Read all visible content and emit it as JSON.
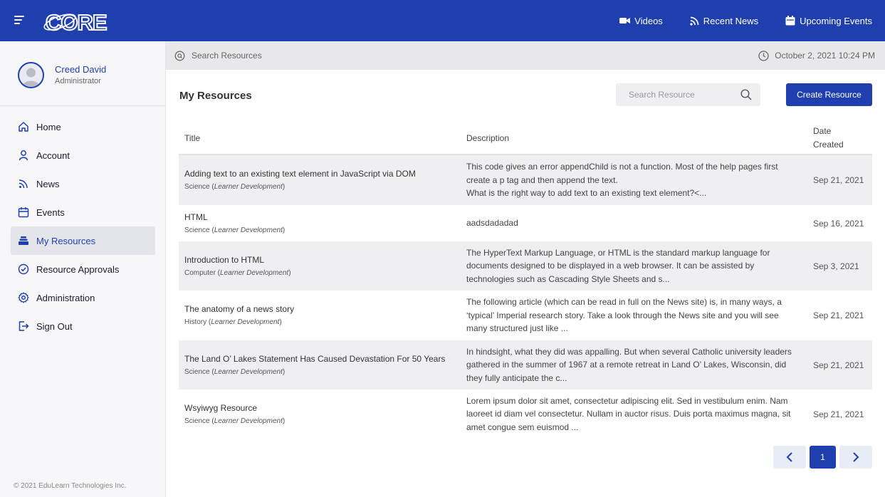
{
  "app": {
    "logo_text": "CORE",
    "brand_color": "#1f3fae"
  },
  "topnav": [
    {
      "label": "Videos",
      "icon": "video-camera-icon"
    },
    {
      "label": "Recent News",
      "icon": "rss-icon"
    },
    {
      "label": "Upcoming Events",
      "icon": "calendar-icon"
    }
  ],
  "profile": {
    "name": "Creed David",
    "role": "Administrator"
  },
  "sidebar": {
    "items": [
      {
        "label": "Home",
        "icon": "home-icon"
      },
      {
        "label": "Account",
        "icon": "user-icon"
      },
      {
        "label": "News",
        "icon": "rss-icon"
      },
      {
        "label": "Events",
        "icon": "calendar-icon"
      },
      {
        "label": "My Resources",
        "icon": "stack-icon",
        "active": true
      },
      {
        "label": "Resource Approvals",
        "icon": "check-circle-icon"
      },
      {
        "label": "Administration",
        "icon": "gear-icon"
      },
      {
        "label": "Sign Out",
        "icon": "sign-out-icon"
      }
    ],
    "copyright": "© 2021 EduLearn Technologies Inc."
  },
  "subbar": {
    "search_placeholder": "Search Resources",
    "datetime": "October 2, 2021 10:24 PM"
  },
  "main": {
    "title": "My Resources",
    "search_placeholder": "Search Resource",
    "create_label": "Create Resource",
    "columns": [
      "Title",
      "Description",
      "Date Created"
    ],
    "rows": [
      {
        "title": "Adding text to an existing text element in JavaScript via DOM",
        "category": "Science",
        "group": "Learner Development",
        "description": "This code gives an error appendChild is not a function. Most of the help pages first create a p tag and then append the text.\nWhat is the right way to add text to an existing text element?<...",
        "date": "Sep 21, 2021"
      },
      {
        "title": "HTML",
        "category": "Science",
        "group": "Learner Development",
        "description": "aadsdadadad",
        "date": "Sep 16, 2021"
      },
      {
        "title": "Introduction to HTML",
        "category": "Computer",
        "group": "Learner Development",
        "description": "The HyperText Markup Language, or HTML is the standard markup language for documents designed to be displayed in a web browser. It can be assisted by technologies such as Cascading Style Sheets and s...",
        "date": "Sep 3, 2021"
      },
      {
        "title": "The anatomy of a news story",
        "category": "History",
        "group": "Learner Development",
        "description": "The following article (which can be read in full on the News site) is, in many ways, a ‘typical’ Imperial research story. Take a look through the News site and you will see many structured just like ...",
        "date": "Sep 21, 2021"
      },
      {
        "title": "The Land O’ Lakes Statement Has Caused Devastation For 50 Years",
        "category": "Science",
        "group": "Learner Development",
        "description": "In hindsight, what they did was appalling. But when several Catholic university leaders gathered in the summer of 1967 at a remote retreat in Land O’ Lakes, Wisconsin, did they fully anticipate the c...",
        "date": "Sep 21, 2021"
      },
      {
        "title": "Wsyiwyg Resource",
        "category": "Science",
        "group": "Learner Development",
        "description": "Lorem ipsum dolor sit amet, consectetur adipiscing elit. Sed in vestibulum enim. Nam laoreet id diam vel consectetur. Nullam in auctor risus. Duis porta maximus magna, sit amet congue sem euismod ...",
        "date": "Sep 21, 2021"
      }
    ],
    "pagination": {
      "current": "1"
    }
  }
}
